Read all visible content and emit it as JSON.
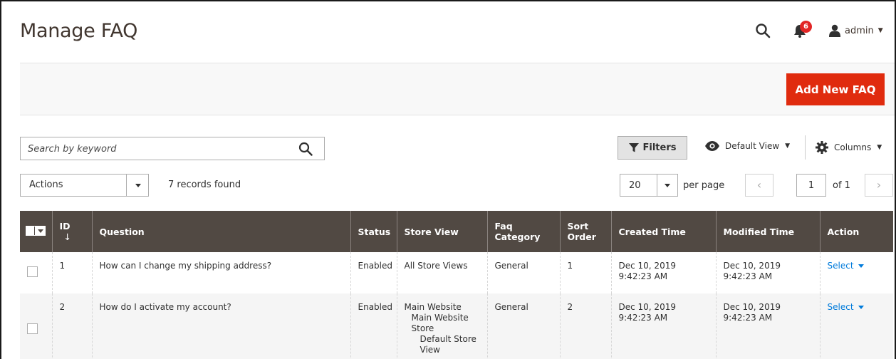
{
  "header": {
    "page_title": "Manage FAQ",
    "notification_count": "6",
    "user_name": "admin",
    "icons": {
      "search": "search-icon",
      "bell": "bell-icon",
      "user": "user-icon"
    }
  },
  "action_bar": {
    "add_button": "Add New FAQ"
  },
  "toolbar": {
    "search_placeholder": "Search by keyword",
    "filters_label": "Filters",
    "view_label": "Default View",
    "columns_label": "Columns",
    "actions_label": "Actions",
    "records_text": "7 records found",
    "per_page_value": "20",
    "per_page_label": "per page",
    "page_value": "1",
    "page_of": "of 1",
    "prev": "‹",
    "next": "›"
  },
  "table": {
    "columns": [
      "ID",
      "Question",
      "Status",
      "Store View",
      "Faq Category",
      "Sort Order",
      "Created Time",
      "Modified Time",
      "Action"
    ],
    "sort_indicator": "↓",
    "rows": [
      {
        "id": "1",
        "question": "How can I change my shipping address?",
        "status": "Enabled",
        "store_view": [
          "All Store Views"
        ],
        "category": "General",
        "sort_order": "1",
        "created": "Dec 10, 2019 9:42:23 AM",
        "modified": "Dec 10, 2019 9:42:23 AM",
        "action": "Select"
      },
      {
        "id": "2",
        "question": "How do I activate my account?",
        "status": "Enabled",
        "store_view": [
          "Main Website",
          "Main Website Store",
          "Default Store View"
        ],
        "category": "General",
        "sort_order": "2",
        "created": "Dec 10, 2019 9:42:23 AM",
        "modified": "Dec 10, 2019 9:42:23 AM",
        "action": "Select"
      }
    ]
  },
  "colors": {
    "accent_button": "#e02b0e",
    "table_header": "#514943",
    "link": "#007bdb",
    "badge": "#e22626"
  }
}
